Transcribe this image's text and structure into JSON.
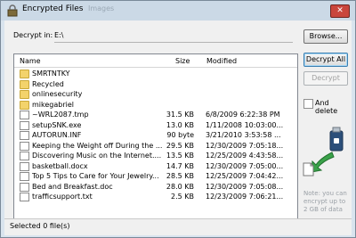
{
  "window": {
    "title": "Encrypted Files",
    "close_glyph": "✕",
    "ghost_title": "Images"
  },
  "path": {
    "label": "Decrypt in:",
    "value": "E:\\"
  },
  "buttons": {
    "browse": "Browse...",
    "decrypt_all": "Decrypt All",
    "decrypt": "Decrypt"
  },
  "columns": {
    "name": "Name",
    "size": "Size",
    "modified": "Modified"
  },
  "rows": [
    {
      "type": "folder",
      "name": "SMRTNTKY",
      "size": "",
      "modified": ""
    },
    {
      "type": "folder",
      "name": "Recycled",
      "size": "",
      "modified": ""
    },
    {
      "type": "folder",
      "name": "onlinesecurity",
      "size": "",
      "modified": ""
    },
    {
      "type": "folder",
      "name": "mikegabriel",
      "size": "",
      "modified": ""
    },
    {
      "type": "file",
      "name": "~WRL2087.tmp",
      "size": "31.5 KB",
      "modified": "6/8/2009 6:22:38 PM"
    },
    {
      "type": "file",
      "name": "setupSNK.exe",
      "size": "13.0 KB",
      "modified": "1/11/2008 10:03:00..."
    },
    {
      "type": "file",
      "name": "AUTORUN.INF",
      "size": "90 byte",
      "modified": "3/21/2010 3:53:58 ..."
    },
    {
      "type": "file",
      "name": "Keeping the Weight off During the ...",
      "size": "29.5 KB",
      "modified": "12/30/2009 7:05:18..."
    },
    {
      "type": "file",
      "name": "Discovering Music on the Internet....",
      "size": "13.5 KB",
      "modified": "12/25/2009 4:43:58..."
    },
    {
      "type": "file",
      "name": "basketball.docx",
      "size": "14.7 KB",
      "modified": "12/30/2009 7:05:00..."
    },
    {
      "type": "file",
      "name": "Top 5 Tips to Care for Your Jewelry...",
      "size": "28.5 KB",
      "modified": "12/25/2009 7:04:42..."
    },
    {
      "type": "file",
      "name": "Bed and Breakfast.doc",
      "size": "28.0 KB",
      "modified": "12/30/2009 7:05:08..."
    },
    {
      "type": "file",
      "name": "trafficsupport.txt",
      "size": "2.5 KB",
      "modified": "12/23/2009 7:06:21..."
    }
  ],
  "checkbox": {
    "label": "And delete",
    "checked": false
  },
  "note": "Note: you can encrypt up to 2 GB of data",
  "status": "Selected 0 file(s)",
  "icons": {
    "app": "lock-icon",
    "folder": "folder-icon",
    "file": "file-icon",
    "usb": "usb-drive-icon",
    "arrow": "green-arrow-icon",
    "document": "document-icon"
  },
  "colors": {
    "accent_button_border": "#3c7fb1",
    "folder": "#f3d36b",
    "arrow": "#3aa24a",
    "close": "#c9463d"
  }
}
